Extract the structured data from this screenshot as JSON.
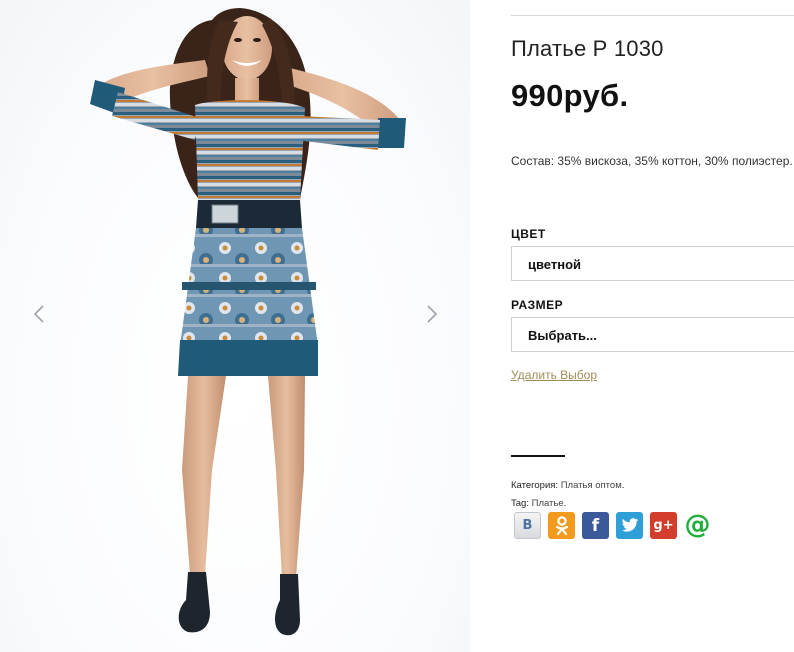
{
  "product": {
    "title": "Платье Р 1030",
    "price": "990руб.",
    "composition": "Состав: 35% вискоза, 35% коттон, 30% полиэстер."
  },
  "attributes": {
    "color_label": "ЦВЕТ",
    "color_value": "цветной",
    "size_label": "РАЗМЕР",
    "size_value": "Выбрать...",
    "reset_label": "Удалить Выбор"
  },
  "meta": {
    "category_prefix": "Категория:",
    "category_link": "Платья оптом",
    "category_suffix": ".",
    "tag_prefix": "Tag:",
    "tag_link": "Платье",
    "tag_suffix": "."
  },
  "share": {
    "vk": "B",
    "ok": "ok",
    "fb": "f",
    "tw": "t",
    "gp": "g+",
    "mail": "@"
  },
  "colors": {
    "accent_link": "#a08c5b",
    "dress_teal": "#1f5a78",
    "dress_orange": "#c9792a"
  }
}
